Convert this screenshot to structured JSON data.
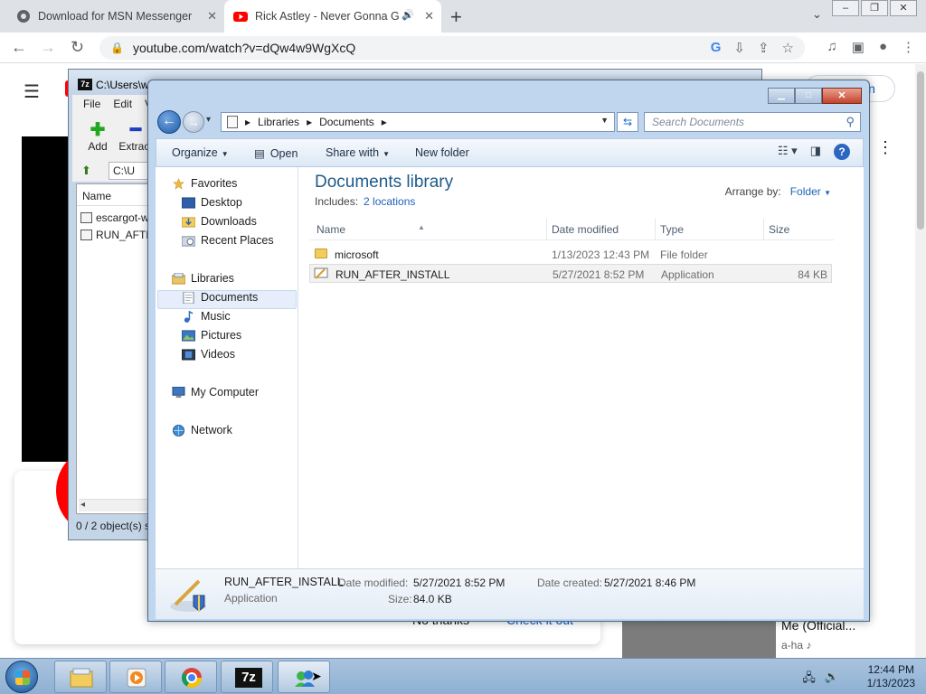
{
  "browser": {
    "tabs": [
      {
        "label": "Download for MSN Messenger | E",
        "close": "✕"
      },
      {
        "label": "Rick Astley - Never Gonna G",
        "close": "✕"
      }
    ],
    "new_tab": "+",
    "url": "youtube.com/watch?v=dQw4w9WgXcQ"
  },
  "youtube": {
    "signin": "in",
    "dialog_left_btn": "No thanks",
    "dialog_right_btn": "Check it out",
    "video_title": "Me (Official...",
    "video_channel": "a-ha ♪"
  },
  "sevenzip": {
    "title": "C:\\Users\\w",
    "menu": [
      "File",
      "Edit",
      "V"
    ],
    "toolbar": {
      "add": "Add",
      "extract": "Extract"
    },
    "address": "C:\\U",
    "col_name": "Name",
    "rows": [
      "escargot-w",
      "RUN_AFTE"
    ],
    "status": "0 / 2 object(s) s"
  },
  "explorer": {
    "breadcrumb": [
      "Libraries",
      "Documents"
    ],
    "search_placeholder": "Search Documents",
    "commands": {
      "organize": "Organize",
      "open": "Open",
      "share": "Share with",
      "new_folder": "New folder"
    },
    "nav": {
      "favorites": "Favorites",
      "desktop": "Desktop",
      "downloads": "Downloads",
      "recent": "Recent Places",
      "libraries": "Libraries",
      "documents": "Documents",
      "music": "Music",
      "pictures": "Pictures",
      "videos": "Videos",
      "computer": "My Computer",
      "network": "Network"
    },
    "library": {
      "title": "Documents library",
      "includes_label": "Includes:",
      "includes_link": "2 locations",
      "arrange_label": "Arrange by:",
      "arrange_value": "Folder"
    },
    "columns": {
      "name": "Name",
      "date": "Date modified",
      "type": "Type",
      "size": "Size"
    },
    "files": [
      {
        "name": "microsoft",
        "date": "1/13/2023 12:43 PM",
        "type": "File folder",
        "size": ""
      },
      {
        "name": "RUN_AFTER_INSTALL",
        "date": "5/27/2021 8:52 PM",
        "type": "Application",
        "size": "84 KB"
      }
    ],
    "details": {
      "name": "RUN_AFTER_INSTALL",
      "type": "Application",
      "modified_label": "Date modified:",
      "modified_value": "5/27/2021 8:52 PM",
      "created_label": "Date created:",
      "created_value": "5/27/2021 8:46 PM",
      "size_label": "Size:",
      "size_value": "84.0 KB"
    }
  },
  "taskbar": {
    "tz_label": "7z",
    "time": "12:44 PM",
    "date": "1/13/2023"
  }
}
